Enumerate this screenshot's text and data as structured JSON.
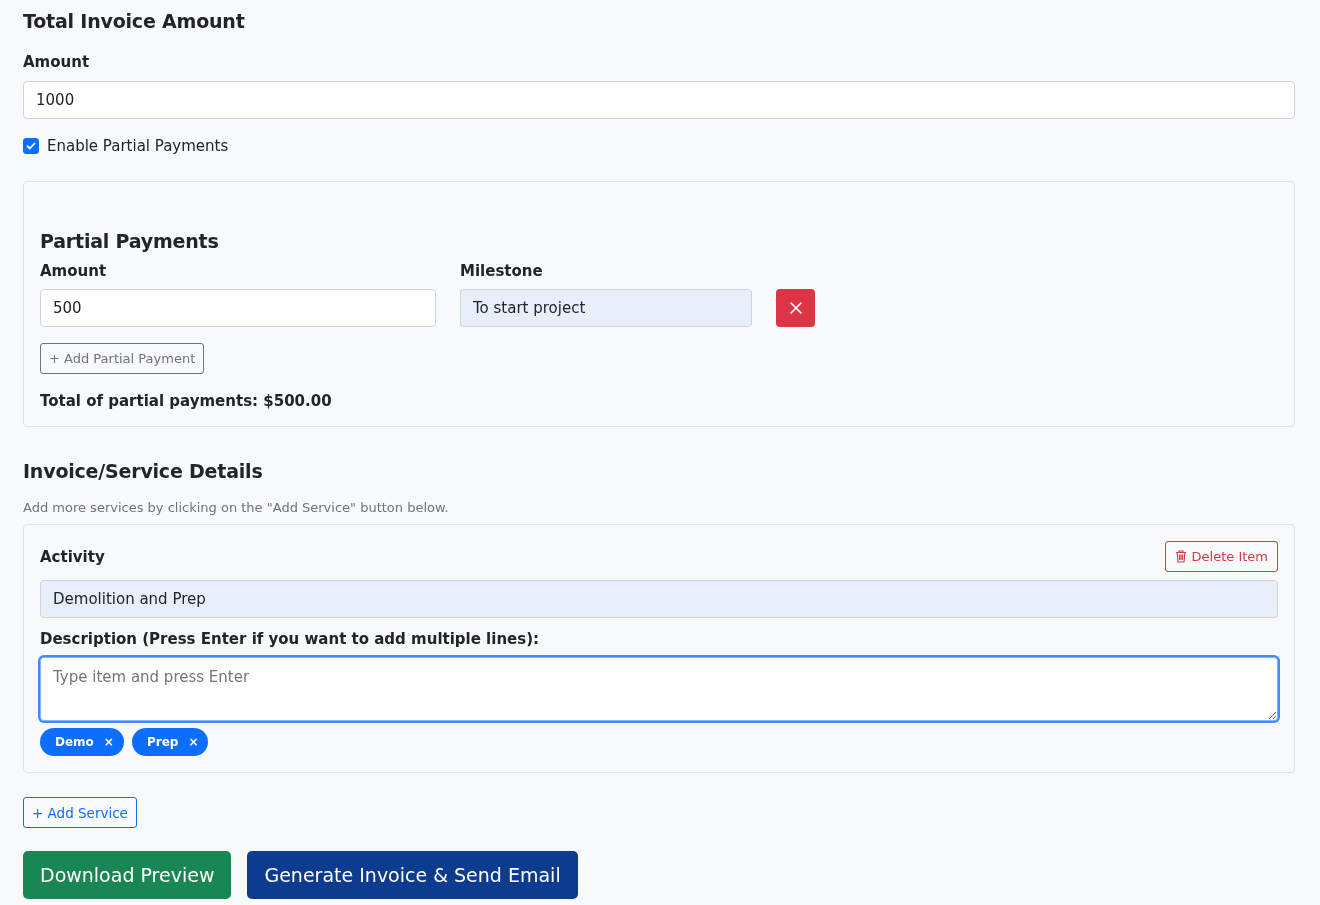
{
  "total_section": {
    "title": "Total Invoice Amount",
    "amount_label": "Amount",
    "amount": "1000"
  },
  "partial_toggle": {
    "label": "Enable Partial Payments",
    "checked": true
  },
  "partial_payments": {
    "title": "Partial Payments",
    "columns": [
      "Amount",
      "Milestone"
    ],
    "rows": [
      {
        "amount": "500",
        "milestone": "To start project"
      }
    ],
    "add_button": "+ Add Partial Payment",
    "total": "Total of partial payments: $500.00"
  },
  "services": {
    "title": "Invoice/Service Details",
    "hint": "Add more services by clicking on the \"Add Service\" button below.",
    "items": [
      {
        "activity_label": "Activity",
        "activity": "Demolition and Prep",
        "delete_button": "Delete Item",
        "description_label": "Description (Press Enter if you want to add multiple lines):",
        "description_placeholder": "Type item and press Enter",
        "focused": true,
        "tags": [
          {
            "label": "Demo",
            "remove": "×"
          },
          {
            "label": "Prep",
            "remove": "×"
          }
        ]
      }
    ],
    "add_button": "+ Add Service"
  },
  "actions": [
    {
      "label": "Download Preview",
      "kind": "success"
    },
    {
      "label": "Generate Invoice & Send Email",
      "kind": "primary"
    }
  ]
}
